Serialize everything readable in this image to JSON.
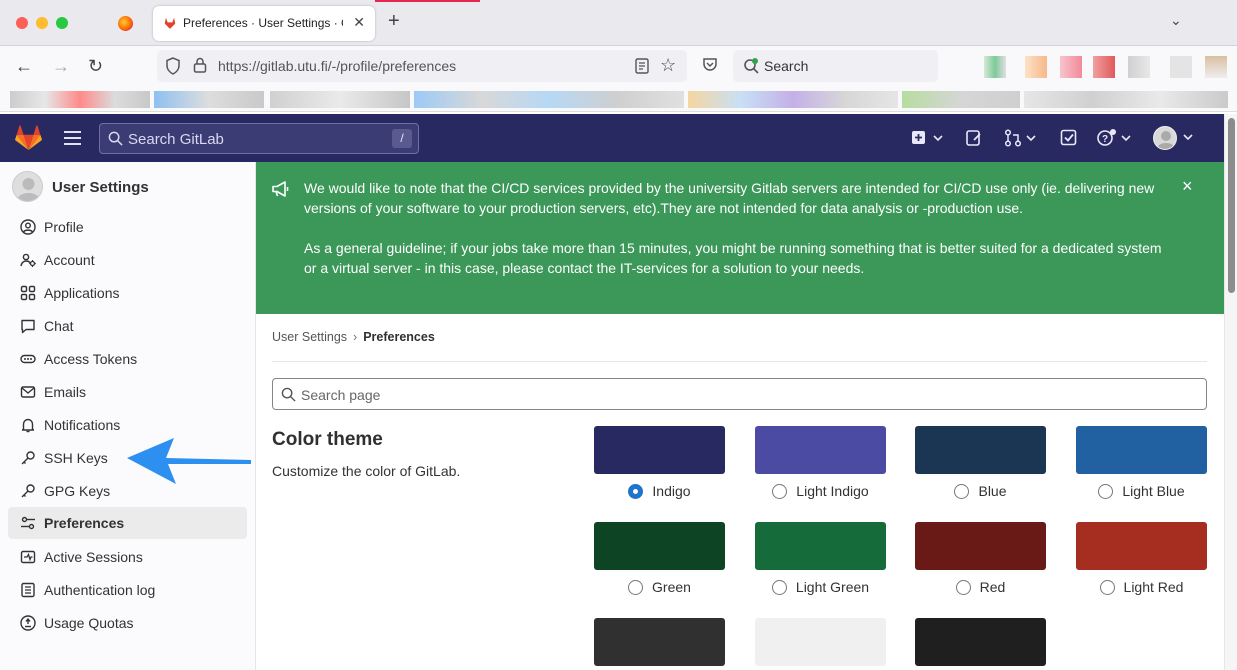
{
  "browser": {
    "tab_title": "Preferences · User Settings · GitLab",
    "url": "https://gitlab.utu.fi/-/profile/preferences",
    "search_placeholder": "Search"
  },
  "gitlab_header": {
    "search_placeholder": "Search GitLab",
    "search_shortcut": "/"
  },
  "sidebar": {
    "title": "User Settings",
    "items": [
      {
        "label": "Profile",
        "icon": "profile-icon"
      },
      {
        "label": "Account",
        "icon": "account-icon"
      },
      {
        "label": "Applications",
        "icon": "applications-icon"
      },
      {
        "label": "Chat",
        "icon": "chat-icon"
      },
      {
        "label": "Access Tokens",
        "icon": "token-icon"
      },
      {
        "label": "Emails",
        "icon": "mail-icon"
      },
      {
        "label": "Notifications",
        "icon": "bell-icon"
      },
      {
        "label": "SSH Keys",
        "icon": "key-icon"
      },
      {
        "label": "GPG Keys",
        "icon": "key-icon"
      },
      {
        "label": "Preferences",
        "icon": "preferences-icon",
        "active": true
      },
      {
        "label": "Active Sessions",
        "icon": "sessions-icon"
      },
      {
        "label": "Authentication log",
        "icon": "log-icon"
      },
      {
        "label": "Usage Quotas",
        "icon": "quota-icon"
      }
    ]
  },
  "banner": {
    "paragraph1": "We would like to note that the CI/CD services provided by the university Gitlab servers are intended for CI/CD use only (ie. delivering new versions of your software to your production servers, etc).They are not intended for data analysis or -production use.",
    "paragraph2": "As a general guideline; if your jobs take more than 15 minutes, you might be running something that is better suited for a dedicated system or a virtual server - in this case, please contact the IT-services for a solution to your needs.",
    "close": "×"
  },
  "breadcrumb": {
    "parent": "User Settings",
    "separator": "›",
    "current": "Preferences"
  },
  "page_search": {
    "placeholder": "Search page"
  },
  "color_theme": {
    "title": "Color theme",
    "description": "Customize the color of GitLab.",
    "selected": "Indigo",
    "themes": [
      {
        "label": "Indigo",
        "color": "#292961"
      },
      {
        "label": "Light Indigo",
        "color": "#4b4ba3"
      },
      {
        "label": "Blue",
        "color": "#1a3652"
      },
      {
        "label": "Light Blue",
        "color": "#2261a1"
      },
      {
        "label": "Green",
        "color": "#0d4524"
      },
      {
        "label": "Light Green",
        "color": "#156b39"
      },
      {
        "label": "Red",
        "color": "#691a16"
      },
      {
        "label": "Light Red",
        "color": "#a62e21"
      },
      {
        "label": "",
        "color": "#303030"
      },
      {
        "label": "",
        "color": "#f0f0f0"
      },
      {
        "label": "",
        "color": "#1f1f1f"
      }
    ]
  }
}
